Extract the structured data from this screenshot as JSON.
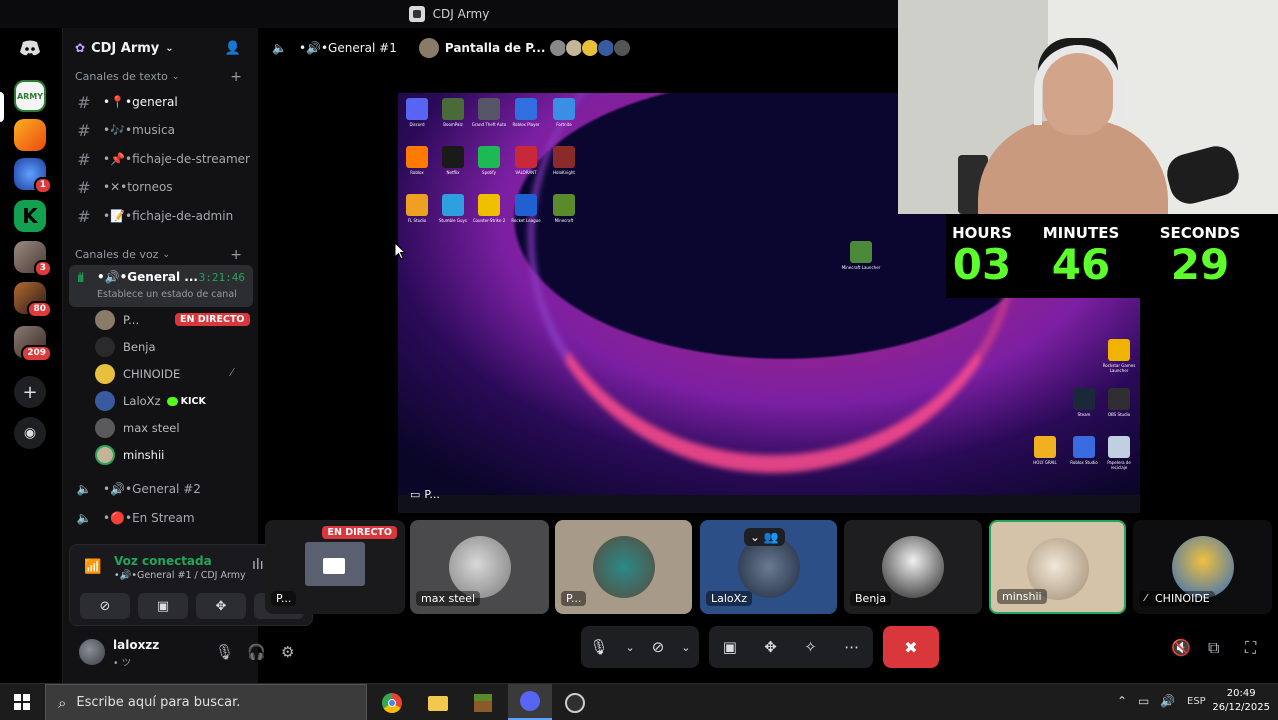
{
  "window": {
    "title": "CDJ Army"
  },
  "servers": [
    {
      "name": "CDJ Army",
      "color": "#2e7d32"
    },
    {
      "name": "server-2",
      "color": "#ff8c1a"
    },
    {
      "name": "server-3",
      "color": "#1e63d6",
      "badge": "1"
    },
    {
      "name": "server-4",
      "color": "#12a150"
    },
    {
      "name": "server-5",
      "color": "#7a5d56",
      "badge": "3"
    },
    {
      "name": "server-6",
      "color": "#3b2a28",
      "badge": "80"
    },
    {
      "name": "server-7",
      "color": "#5a4a44",
      "badge": "209"
    }
  ],
  "sidebar": {
    "server_name": "CDJ Army",
    "text_category": "Canales de texto",
    "text_channels": [
      {
        "label": "•📍•general",
        "emoji_color": "#e53935"
      },
      {
        "label": "•🎶•musica",
        "emoji_color": "#7e57c2"
      },
      {
        "label": "•📌•fichaje-de-streamer",
        "emoji_color": "#e53935"
      },
      {
        "label": "•✕•torneos",
        "emoji_color": "#9e9e9e"
      },
      {
        "label": "•📝•fichaje-de-admin",
        "emoji_color": "#eeeeee"
      }
    ],
    "voice_category": "Canales de voz",
    "active_voice": {
      "name": "•🔊•General ...",
      "time": "3:21:46",
      "status": "Establece un estado de canal"
    },
    "members": [
      {
        "name": "P...",
        "live": "EN DIRECTO"
      },
      {
        "name": "Benja"
      },
      {
        "name": "CHINOIDE"
      },
      {
        "name": "LaloXz",
        "tag": "KICK"
      },
      {
        "name": "max steel"
      },
      {
        "name": "minshii"
      }
    ],
    "other_voice": [
      {
        "label": "•🔊•General #2"
      },
      {
        "label": "•🔴•En Stream"
      }
    ]
  },
  "voice_panel": {
    "title": "Voz conectada",
    "subtitle": "•🔊•General #1 / CDJ Army"
  },
  "user": {
    "name": "laloxzz",
    "status": "• ツ"
  },
  "main_header": {
    "channel": "•🔊•General #1",
    "stream": "Pantalla de P..."
  },
  "screen": {
    "presenter_label": "P..."
  },
  "desktop_icons": [
    {
      "label": "Discord",
      "color": "#5865f2"
    },
    {
      "label": "BoomPalz",
      "color": "#4a6a3a"
    },
    {
      "label": "Grand Theft Auto",
      "color": "#556"
    },
    {
      "label": "Roblox Player",
      "color": "#2f6fe0"
    },
    {
      "label": "Fortnite",
      "color": "#3a8ee6"
    },
    {
      "label": "Roblox",
      "color": "#ff7a00"
    },
    {
      "label": "Netflix",
      "color": "#1a1a1a"
    },
    {
      "label": "Spotify",
      "color": "#1db954"
    },
    {
      "label": "VALORANT",
      "color": "#c8283a"
    },
    {
      "label": "HoloKnight",
      "color": "#8a2a2a"
    },
    {
      "label": "FL Studio",
      "color": "#f0a020"
    },
    {
      "label": "Stumble Guys",
      "color": "#2ea0e0"
    },
    {
      "label": "Counter-Strike 2",
      "color": "#f0c000"
    },
    {
      "label": "Rocket League",
      "color": "#2060d0"
    },
    {
      "label": "Minecraft",
      "color": "#5a8a2a"
    },
    {
      "label": "Minecraft Launcher",
      "color": "#4a8a3a"
    },
    {
      "label": "Rockstar Games Launcher",
      "color": "#f0b400"
    },
    {
      "label": "Steam",
      "color": "#1b2838"
    },
    {
      "label": "OBS Studio",
      "color": "#302e31"
    },
    {
      "label": "Roblox Studio",
      "color": "#3a6ae0"
    },
    {
      "label": "HOLY GRAIL",
      "color": "#f0b020"
    },
    {
      "label": "Papelera de reciclaje",
      "color": "#c0d0e0"
    }
  ],
  "timer": {
    "hours_label": "HOURS",
    "minutes_label": "MINUTES",
    "seconds_label": "SECONDS",
    "hours": "03",
    "minutes": "46",
    "seconds": "29"
  },
  "tiles": [
    {
      "name": "P...",
      "live": "EN DIRECTO",
      "color": "#2a2a2e"
    },
    {
      "name": "max steel",
      "color": "#4a4a4c"
    },
    {
      "name": "P...",
      "color": "#a89a88"
    },
    {
      "name": "LaloXz",
      "color": "#2d4f88"
    },
    {
      "name": "Benja",
      "color": "#1e1e20"
    },
    {
      "name": "minshii",
      "color": "#d4c3a8"
    },
    {
      "name": "CHINOIDE",
      "color": "#0e0e10"
    }
  ],
  "taskbar": {
    "search_placeholder": "Escribe aquí para buscar.",
    "lang": "ESP",
    "time": "20:49",
    "date": "26/12/2025"
  }
}
